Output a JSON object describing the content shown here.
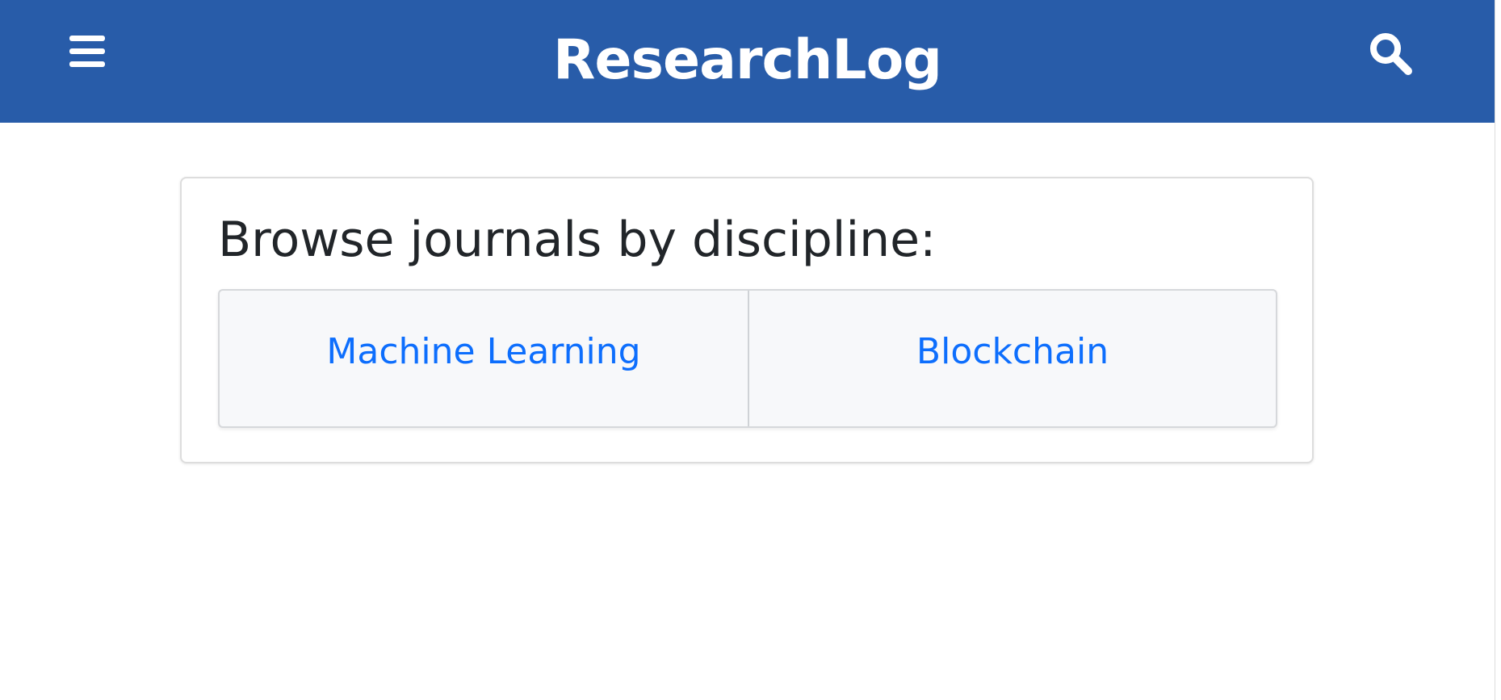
{
  "header": {
    "title": "ResearchLog",
    "background_color": "#285ca9",
    "menu_icon": "hamburger-menu-icon",
    "search_icon": "search-icon"
  },
  "main": {
    "card": {
      "heading": "Browse journals by discipline:",
      "disciplines": [
        {
          "label": "Machine Learning"
        },
        {
          "label": "Blockchain"
        }
      ],
      "link_color": "#0d6efd"
    }
  }
}
